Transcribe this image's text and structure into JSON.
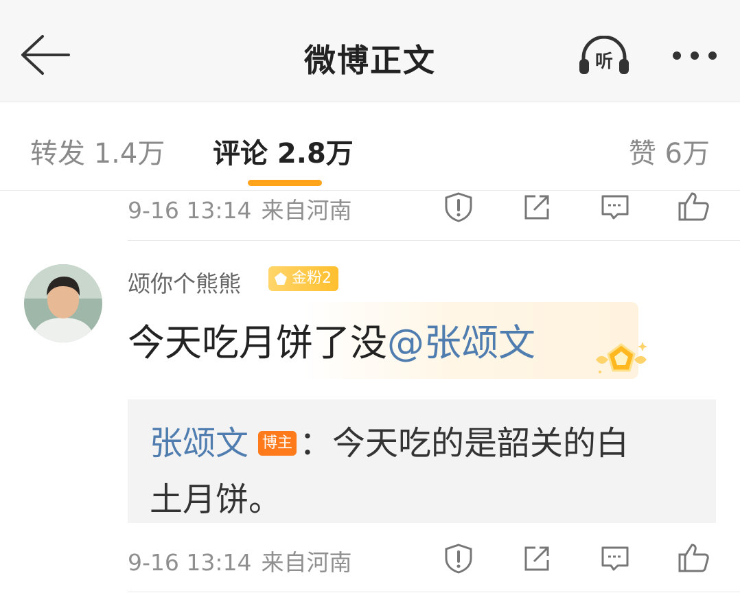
{
  "header": {
    "title": "微博正文",
    "listen_label": "听",
    "icons": [
      "back-arrow-icon",
      "listen-headphones-icon",
      "more-dots-icon"
    ]
  },
  "tabs": {
    "reposts": "转发 1.4万",
    "comments": "评论 2.8万",
    "likes": "赞 6万",
    "active": "comments",
    "accent_color": "#ffa31a"
  },
  "previous_comment": {
    "time": "9-16 13:14",
    "location": "来自河南"
  },
  "comment": {
    "username": "颂你个熊熊",
    "fan_badge": "金粉2",
    "text_plain": "今天吃月饼了没",
    "text_mention": "@张颂文",
    "time": "9-16 13:14",
    "location": "来自河南",
    "reply": {
      "author": "张颂文",
      "author_badge": "博主",
      "separator": "：",
      "text_line1": "今天吃的是韶关的白",
      "text_line2": "土月饼。"
    }
  },
  "actions": [
    "report-icon",
    "share-icon",
    "comment-icon",
    "like-icon"
  ],
  "colors": {
    "link": "#507daf",
    "host_badge": "#ff7a1a",
    "fan_badge": "#ffbf2e"
  }
}
